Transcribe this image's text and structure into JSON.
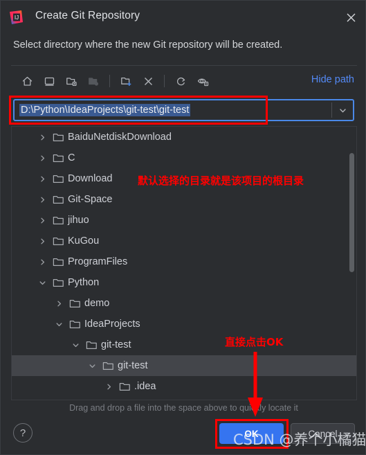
{
  "window": {
    "title": "Create Git Repository",
    "logo_icon": "intellij-idea-logo",
    "close_icon": "close-icon",
    "subtitle": "Select directory where the new Git repository will be created."
  },
  "toolbar": {
    "buttons": [
      {
        "name": "home-icon",
        "tooltip": "Home"
      },
      {
        "name": "desktop-icon",
        "tooltip": "Desktop"
      },
      {
        "name": "project-folder-icon",
        "tooltip": "Project Directory"
      },
      {
        "name": "module-folder-icon",
        "tooltip": "Module Directory"
      },
      {
        "name": "new-folder-icon",
        "tooltip": "New Folder"
      },
      {
        "name": "delete-icon",
        "tooltip": "Delete"
      },
      {
        "name": "refresh-icon",
        "tooltip": "Refresh"
      },
      {
        "name": "show-hidden-files-icon",
        "tooltip": "Show Hidden Files"
      }
    ],
    "hide_path_label": "Hide path"
  },
  "path_field": {
    "value": "D:\\Python\\IdeaProjects\\git-test\\git-test",
    "placeholder": "",
    "dropdown_icon": "chevron-down-icon"
  },
  "tree": {
    "rows": [
      {
        "label": "BaiduNetdiskDownload",
        "depth": 1,
        "state": "collapsed",
        "selected": false
      },
      {
        "label": "C",
        "depth": 1,
        "state": "collapsed",
        "selected": false
      },
      {
        "label": "Download",
        "depth": 1,
        "state": "collapsed",
        "selected": false
      },
      {
        "label": "Git-Space",
        "depth": 1,
        "state": "collapsed",
        "selected": false
      },
      {
        "label": "jihuo",
        "depth": 1,
        "state": "collapsed",
        "selected": false
      },
      {
        "label": "KuGou",
        "depth": 1,
        "state": "collapsed",
        "selected": false
      },
      {
        "label": "ProgramFiles",
        "depth": 1,
        "state": "collapsed",
        "selected": false
      },
      {
        "label": "Python",
        "depth": 1,
        "state": "expanded",
        "selected": false
      },
      {
        "label": "demo",
        "depth": 2,
        "state": "collapsed",
        "selected": false
      },
      {
        "label": "IdeaProjects",
        "depth": 2,
        "state": "expanded",
        "selected": false
      },
      {
        "label": "git-test",
        "depth": 3,
        "state": "expanded",
        "selected": false
      },
      {
        "label": "git-test",
        "depth": 4,
        "state": "expanded",
        "selected": true
      },
      {
        "label": ".idea",
        "depth": 5,
        "state": "collapsed",
        "selected": false
      }
    ],
    "scrollbar": "vertical-scrollbar"
  },
  "hint": "Drag and drop a file into the space above to quickly locate it",
  "footer": {
    "help_label": "?",
    "ok_label": "OK",
    "cancel_label": "Cancel"
  },
  "annotations": {
    "note_directory": "默认选择的目录就是该项目的根目录",
    "note_click_ok": "直接点击OK",
    "highlight_color": "#ff0000",
    "arrow": "down-arrow-annotation"
  },
  "watermark": "CSDN @养个小橘猫",
  "colors": {
    "dialog_bg": "#2b2d30",
    "accent_blue": "#3574f0",
    "link_blue": "#548af7",
    "selection_bg": "#3a5a92",
    "row_selected_bg": "#43454a",
    "text_primary": "#ced0d6",
    "text_muted": "#7a7d83",
    "annotation_red": "#ff0000"
  }
}
